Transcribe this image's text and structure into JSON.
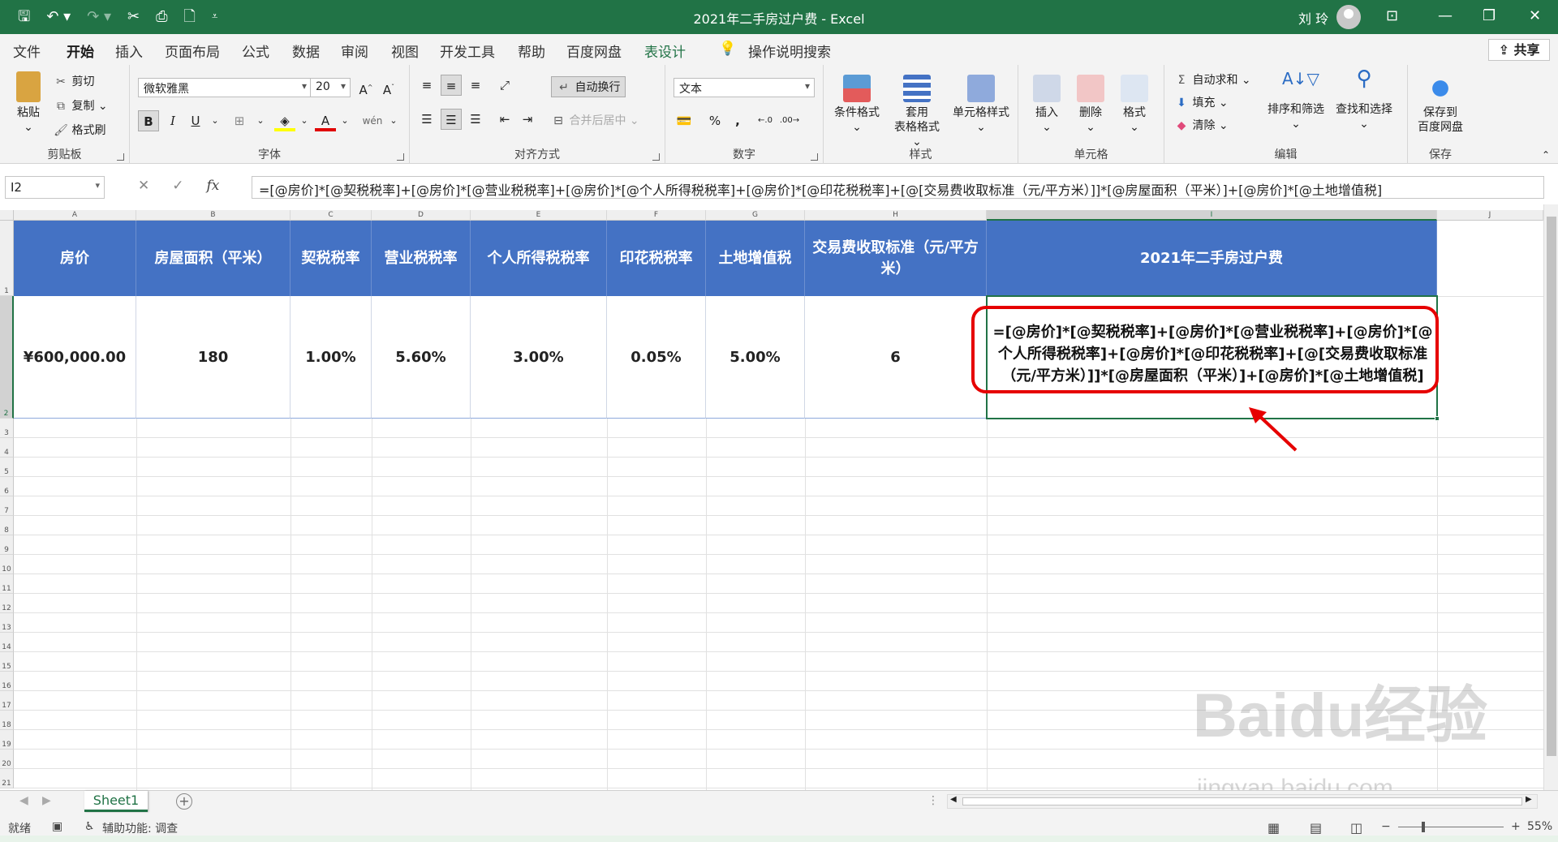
{
  "window": {
    "title": "2021年二手房过户费 - Excel",
    "user": "刘 玲"
  },
  "tabs": [
    "文件",
    "开始",
    "插入",
    "页面布局",
    "公式",
    "数据",
    "审阅",
    "视图",
    "开发工具",
    "帮助",
    "百度网盘",
    "表设计"
  ],
  "active_tab": "开始",
  "tell_me": "操作说明搜索",
  "share": "共享",
  "ribbon": {
    "clipboard": {
      "paste": "粘贴",
      "cut": "剪切",
      "copy": "复制",
      "format_painter": "格式刷",
      "name": "剪贴板"
    },
    "font": {
      "family": "微软雅黑",
      "size": "20",
      "bold": "B",
      "italic": "I",
      "underline": "U",
      "name": "字体"
    },
    "alignment": {
      "wrap": "自动换行",
      "merge": "合并后居中",
      "name": "对齐方式"
    },
    "number": {
      "format": "文本",
      "name": "数字"
    },
    "styles": {
      "conditional": "条件格式",
      "table_format_1": "套用",
      "table_format_2": "表格格式",
      "cell_styles": "单元格样式",
      "name": "样式"
    },
    "cells": {
      "insert": "插入",
      "delete": "删除",
      "format": "格式",
      "name": "单元格"
    },
    "editing": {
      "autosum": "自动求和",
      "fill": "填充",
      "clear": "清除",
      "sort": "排序和筛选",
      "find": "查找和选择",
      "name": "编辑"
    },
    "save": {
      "line1": "保存到",
      "line2": "百度网盘",
      "name": "保存"
    }
  },
  "formula_bar": {
    "name_box": "I2",
    "formula": "=[@房价]*[@契税税率]+[@房价]*[@营业税税率]+[@房价]*[@个人所得税税率]+[@房价]*[@印花税税率]+[@[交易费收取标准（元/平方米）]]*[@房屋面积（平米）]+[@房价]*[@土地增值税]"
  },
  "columns": [
    "A",
    "B",
    "C",
    "D",
    "E",
    "F",
    "G",
    "H",
    "I",
    "J"
  ],
  "rows": [
    "1",
    "2",
    "3",
    "4",
    "5",
    "6",
    "7",
    "8",
    "9",
    "10",
    "11",
    "12",
    "13",
    "14",
    "15",
    "16",
    "17",
    "18",
    "19",
    "20",
    "21"
  ],
  "table": {
    "headers": [
      "房价",
      "房屋面积（平米）",
      "契税税率",
      "营业税税率",
      "个人所得税税率",
      "印花税税率",
      "土地增值税",
      "交易费收取标准（元/平方米）",
      "2021年二手房过户费"
    ],
    "values": [
      "¥600,000.00",
      "180",
      "1.00%",
      "5.60%",
      "3.00%",
      "0.05%",
      "5.00%",
      "6"
    ],
    "formula_display": "=[@房价]*[@契税税率]+[@房价]*[@营业税税率]+[@房价]*[@个人所得税税率]+[@房价]*[@印花税税率]+[@[交易费收取标准（元/平方米）]]*[@房屋面积（平米）]+[@房价]*[@土地增值税]"
  },
  "sheet_tab": "Sheet1",
  "status": {
    "ready": "就绪",
    "accessibility": "辅助功能: 调查",
    "zoom": "55%"
  },
  "watermark": {
    "logo": "Baidu经验",
    "url": "jingyan.baidu.com"
  },
  "colors": {
    "excel_green": "#217346",
    "header_blue": "#4472c4",
    "annotation_red": "#e60000"
  }
}
